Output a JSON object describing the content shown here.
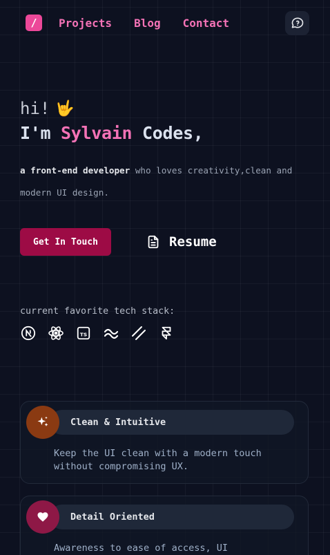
{
  "nav": {
    "logo_glyph": "/",
    "links": [
      "Projects",
      "Blog",
      "Contact"
    ]
  },
  "hero": {
    "greeting": "hi!",
    "wave_emoji": "🤟",
    "headline_prefix": "I'm ",
    "headline_name": "Sylvain",
    "headline_suffix": " Codes,",
    "desc_strong": "a front-end developer",
    "desc_rest": " who loves creativity,clean and modern UI design."
  },
  "cta": {
    "touch_label": "Get In Touch",
    "resume_label": "Resume"
  },
  "stack": {
    "label": "current favorite tech stack:",
    "icons": [
      "nextjs-icon",
      "react-icon",
      "typescript-icon",
      "tailwind-icon",
      "linear-icon",
      "framer-icon"
    ]
  },
  "cards": [
    {
      "title": "Clean & Intuitive",
      "text": "Keep the UI clean with a modern touch without compromising UX.",
      "icon": "sparkles-icon",
      "color": "#8a3a12"
    },
    {
      "title": "Detail Oriented",
      "text": "Awareness to ease of access, UI",
      "icon": "heart-icon",
      "color": "#8e1846"
    }
  ],
  "colors": {
    "accent": "#f472b6",
    "button": "#9d0b45",
    "background": "#0d1120"
  }
}
